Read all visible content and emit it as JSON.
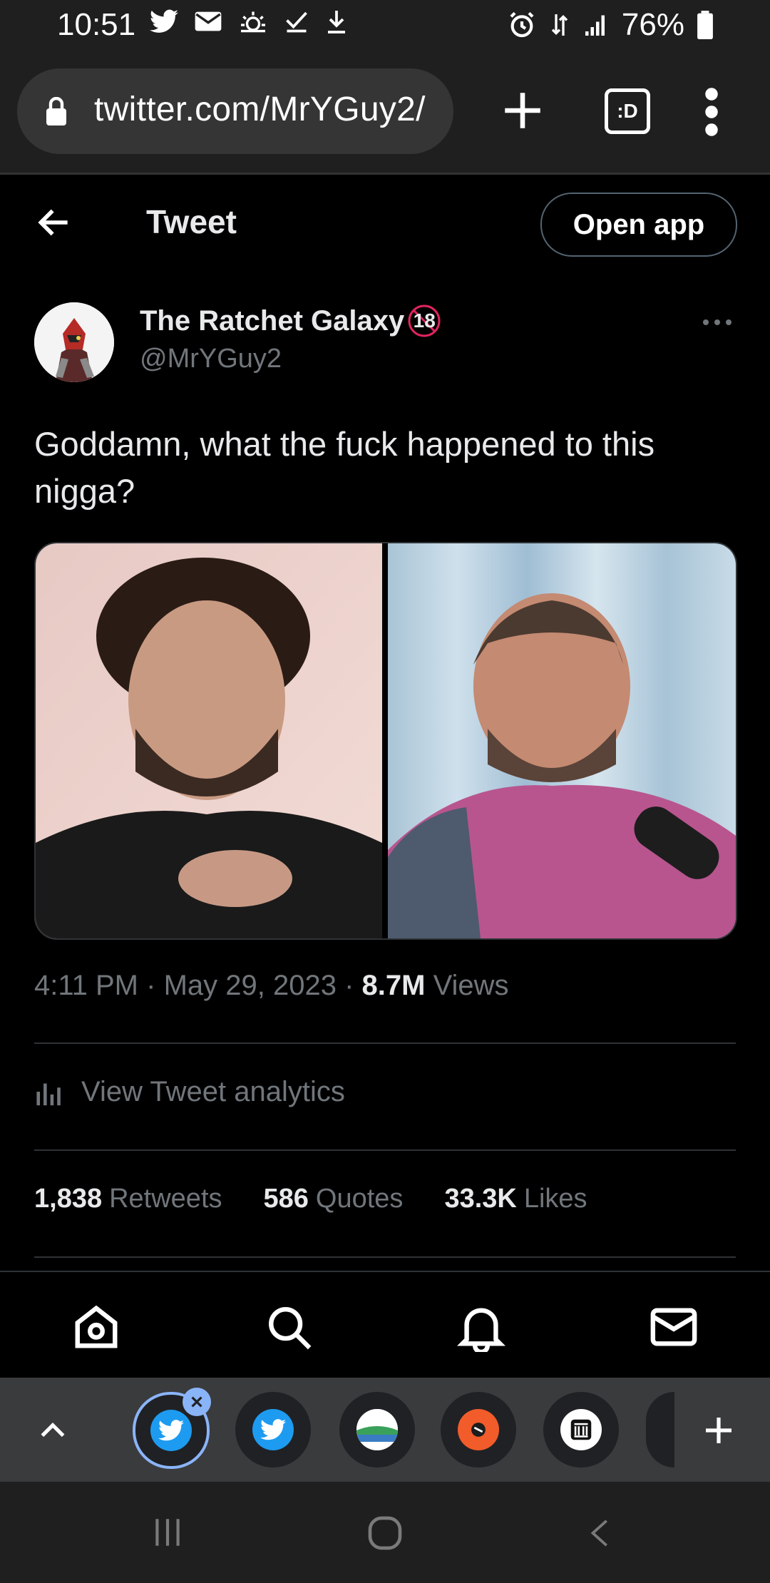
{
  "status_bar": {
    "time": "10:51",
    "battery": "76%",
    "left_icons": [
      "twitter-icon",
      "mail-icon",
      "weather-icon",
      "check-icon",
      "download-icon"
    ],
    "right_icons": [
      "alarm-icon",
      "data-icon",
      "signal-icon",
      "battery-icon"
    ]
  },
  "browser": {
    "url": "twitter.com/MrYGuy2/",
    "tabs_label": ":D"
  },
  "header": {
    "title": "Tweet",
    "open_app": "Open app"
  },
  "tweet": {
    "author_name": "The Ratchet Galaxy",
    "author_badge": "18",
    "handle": "@MrYGuy2",
    "text": "Goddamn, what the fuck happened to this nigga?",
    "time": "4:11 PM",
    "date": "May 29, 2023",
    "views_count": "8.7M",
    "views_label": "Views",
    "analytics": "View Tweet analytics",
    "retweets_count": "1,838",
    "retweets_label": "Retweets",
    "quotes_count": "586",
    "quotes_label": "Quotes",
    "likes_count": "33.3K",
    "likes_label": "Likes"
  },
  "colors": {
    "background": "#000000",
    "muted": "#71767b",
    "divider": "#2f3336",
    "twitter_blue": "#1d9bf0"
  }
}
